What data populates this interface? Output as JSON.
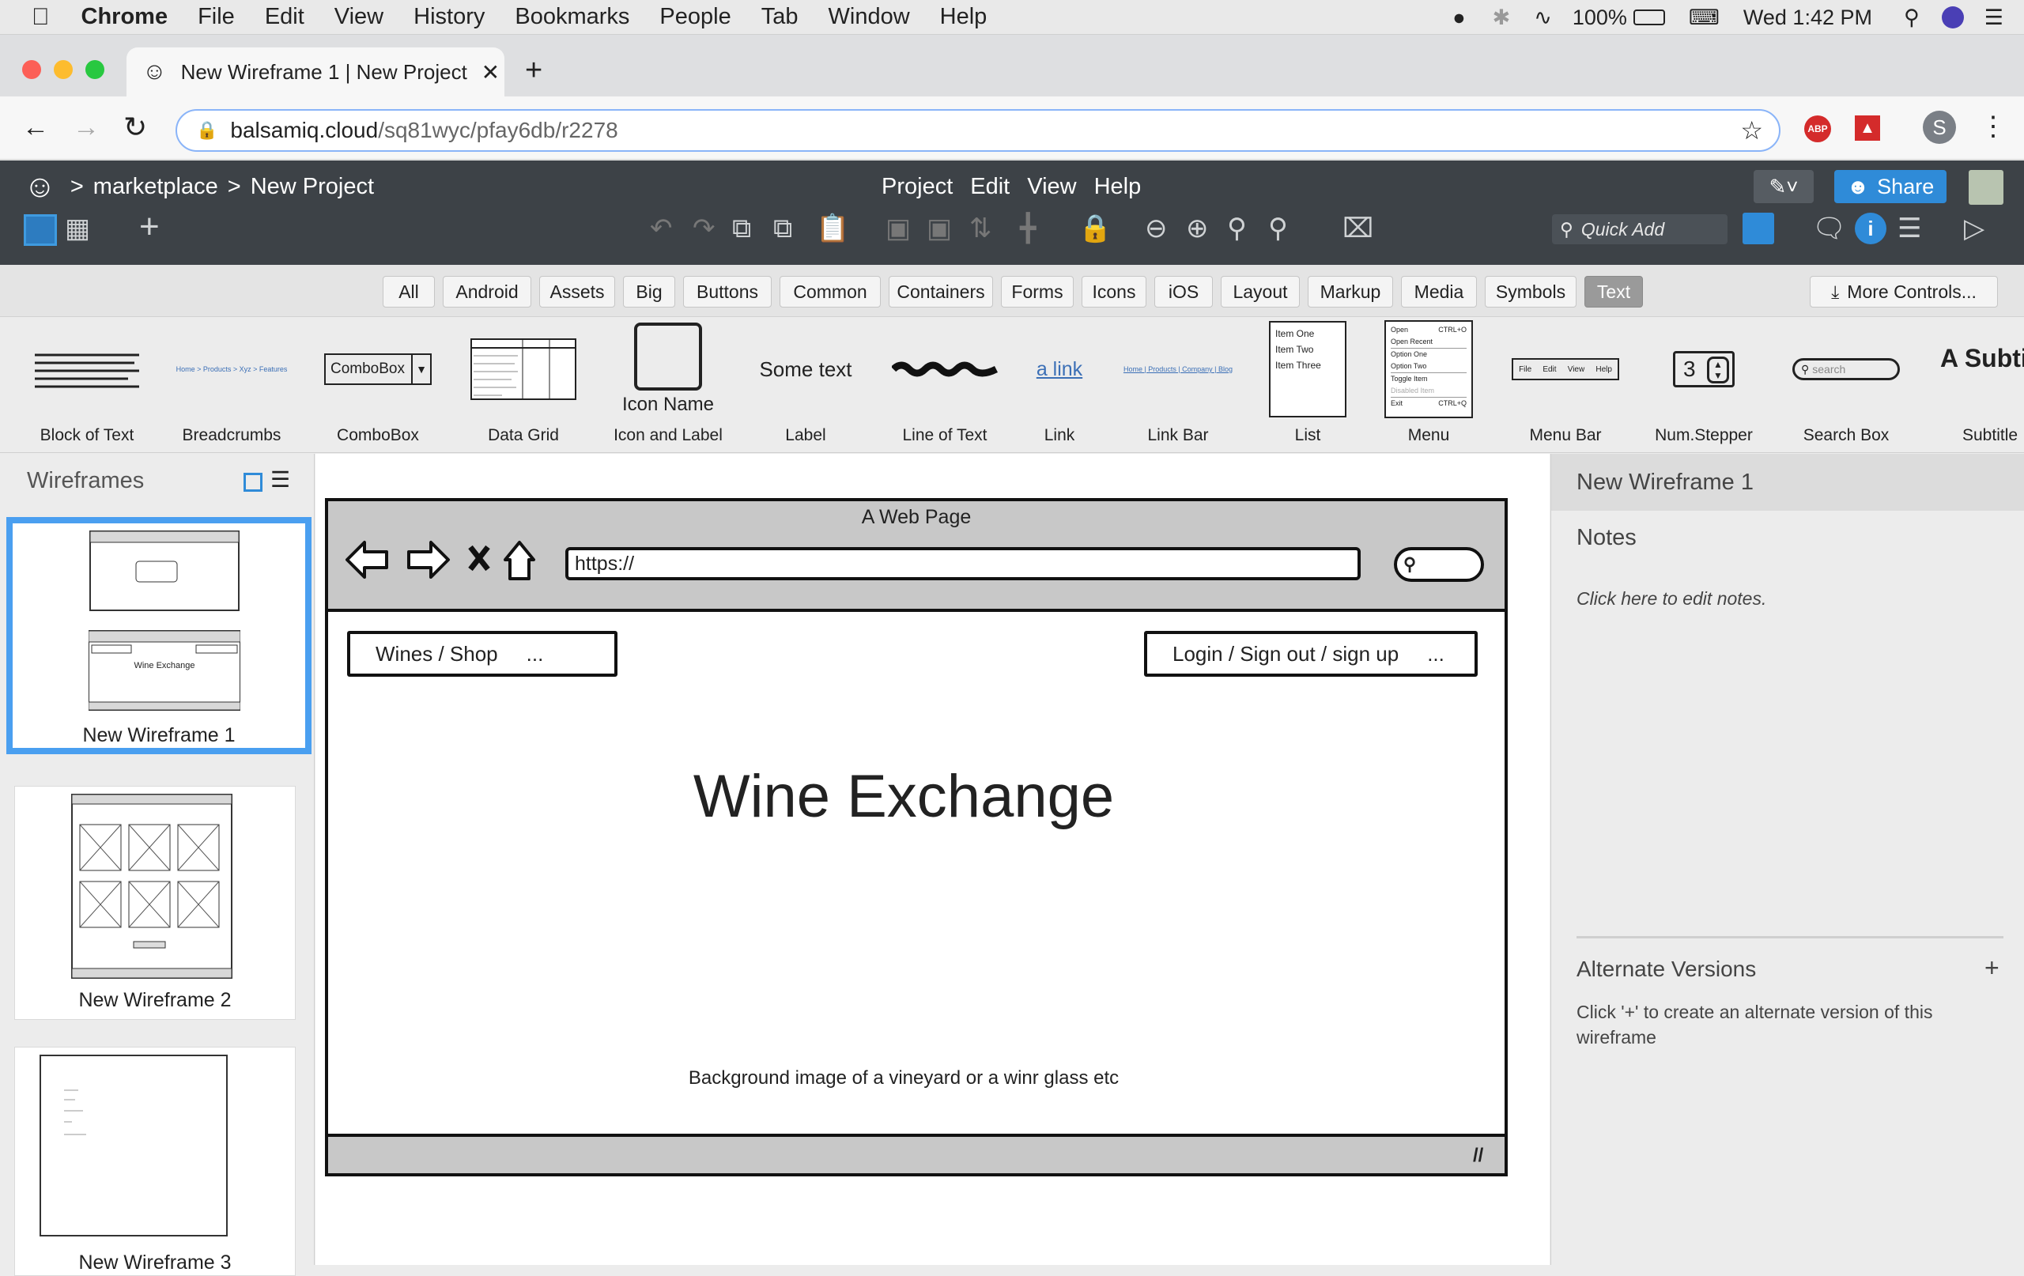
{
  "macmenu": {
    "app": "Chrome",
    "items": [
      "File",
      "Edit",
      "View",
      "History",
      "Bookmarks",
      "People",
      "Tab",
      "Window",
      "Help"
    ],
    "battery": "100%",
    "clock": "Wed 1:42 PM"
  },
  "browser": {
    "tab_title": "New Wireframe 1 | New Project",
    "url_host": "balsamiq.cloud",
    "url_path": "/sq81wyc/pfay6db/r2278",
    "profile_initial": "S",
    "abp": "ABP"
  },
  "balsamiq": {
    "breadcrumb": [
      "marketplace",
      "New Project"
    ],
    "menu": [
      "Project",
      "Edit",
      "View",
      "Help"
    ],
    "quick_add": "Quick Add",
    "share": "Share",
    "filters": [
      "All",
      "Android",
      "Assets",
      "Big",
      "Buttons",
      "Common",
      "Containers",
      "Forms",
      "Icons",
      "iOS",
      "Layout",
      "Markup",
      "Media",
      "Symbols",
      "Text"
    ],
    "active_filter": "Text",
    "more_controls": "More Controls...",
    "controls": [
      {
        "name": "Block of Text",
        "preview": ""
      },
      {
        "name": "Breadcrumbs",
        "preview": "Home > Products > Xyz > Features"
      },
      {
        "name": "ComboBox",
        "preview": "ComboBox"
      },
      {
        "name": "Data Grid",
        "preview": ""
      },
      {
        "name": "Icon and Label",
        "preview": "Icon Name"
      },
      {
        "name": "Label",
        "preview": "Some text"
      },
      {
        "name": "Line of Text",
        "preview": ""
      },
      {
        "name": "Link",
        "preview": "a link"
      },
      {
        "name": "Link Bar",
        "preview": "Home | Products | Company | Blog"
      },
      {
        "name": "List",
        "preview": [
          "Item One",
          "Item Two",
          "Item Three"
        ]
      },
      {
        "name": "Menu",
        "preview": [
          "Open",
          "Open Recent",
          "Option One",
          "Option Two",
          "Toggle Item",
          "Disabled Item",
          "Exit"
        ]
      },
      {
        "name": "Menu Bar",
        "preview": [
          "File",
          "Edit",
          "View",
          "Help"
        ]
      },
      {
        "name": "Num.Stepper",
        "preview": "3"
      },
      {
        "name": "Search Box",
        "preview": "search"
      },
      {
        "name": "Subtitle",
        "preview": "A Subtit"
      }
    ],
    "menu_shortcuts": [
      "CTRL+O",
      "CTRL+Q"
    ],
    "sidebar": {
      "title": "Wireframes",
      "items": [
        {
          "label": "New Wireframe 1",
          "thumb_text": "Wine Exchange"
        },
        {
          "label": "New Wireframe 2"
        },
        {
          "label": "New Wireframe 3"
        }
      ]
    },
    "wireframe": {
      "window_title": "A Web Page",
      "url": "https://",
      "nav_left": "Wines / Shop",
      "nav_left_more": "...",
      "nav_right": "Login / Sign out / sign up",
      "nav_right_more": "...",
      "headline": "Wine Exchange",
      "bg_note": "Background image of a vineyard or a winr glass etc"
    },
    "right_panel": {
      "title": "New Wireframe 1",
      "notes_label": "Notes",
      "notes_placeholder": "Click here to edit notes.",
      "alt_title": "Alternate Versions",
      "alt_add": "+",
      "alt_desc": "Click '+' to create an alternate version of this wireframe"
    }
  }
}
